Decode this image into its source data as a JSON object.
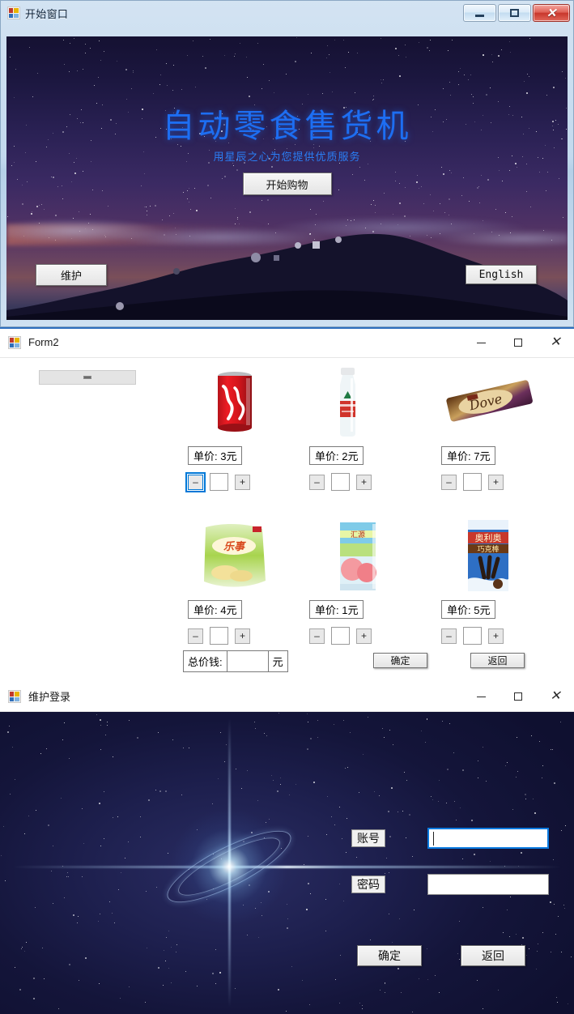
{
  "window_start": {
    "title": "开始窗口",
    "icon": "vb-app-icon",
    "controls": {
      "minimize": "minimize-icon",
      "maximize": "maximize-icon",
      "close": "close-icon"
    },
    "hero": {
      "title": "自动零食售货机",
      "subtitle": "用星辰之心为您提供优质服务",
      "start_button": "开始购物",
      "maintain_button": "维护",
      "english_button": "English",
      "title_color": "#1d6ef2",
      "subtitle_color": "#2a7ef5"
    }
  },
  "window_form2": {
    "title": "Form2",
    "icon": "vb-app-icon",
    "controls": {
      "minimize": "minimize-icon",
      "maximize": "maximize-icon",
      "close": "close-icon"
    },
    "top_button": "–",
    "products": [
      {
        "name": "可口可乐",
        "price_label": "单价: 3元",
        "qty": "",
        "minus": "–",
        "plus": "+",
        "minus_focused": true
      },
      {
        "name": "农夫山泉矿泉水",
        "price_label": "单价: 2元",
        "qty": "",
        "minus": "–",
        "plus": "+",
        "minus_focused": false
      },
      {
        "name": "德芙巧克力",
        "price_label": "单价: 7元",
        "qty": "",
        "minus": "–",
        "plus": "+",
        "minus_focused": false
      },
      {
        "name": "乐事薯片",
        "price_label": "单价: 4元",
        "qty": "",
        "minus": "–",
        "plus": "+",
        "minus_focused": false
      },
      {
        "name": "汇源桃汁",
        "price_label": "单价: 1元",
        "qty": "",
        "minus": "–",
        "plus": "+",
        "minus_focused": false
      },
      {
        "name": "奥利奥巧克棒",
        "price_label": "单价: 5元",
        "qty": "",
        "minus": "–",
        "plus": "+",
        "minus_focused": false
      }
    ],
    "total": {
      "label": "总价钱:",
      "value": "",
      "unit": "元"
    },
    "confirm_button": "确定",
    "back_button": "返回"
  },
  "window_login": {
    "title": "维护登录",
    "icon": "vb-app-icon",
    "controls": {
      "minimize": "minimize-icon",
      "maximize": "maximize-icon",
      "close": "close-icon"
    },
    "account": {
      "label": "账号",
      "value": ""
    },
    "password": {
      "label": "密码",
      "value": ""
    },
    "confirm_button": "确定",
    "back_button": "返回"
  }
}
